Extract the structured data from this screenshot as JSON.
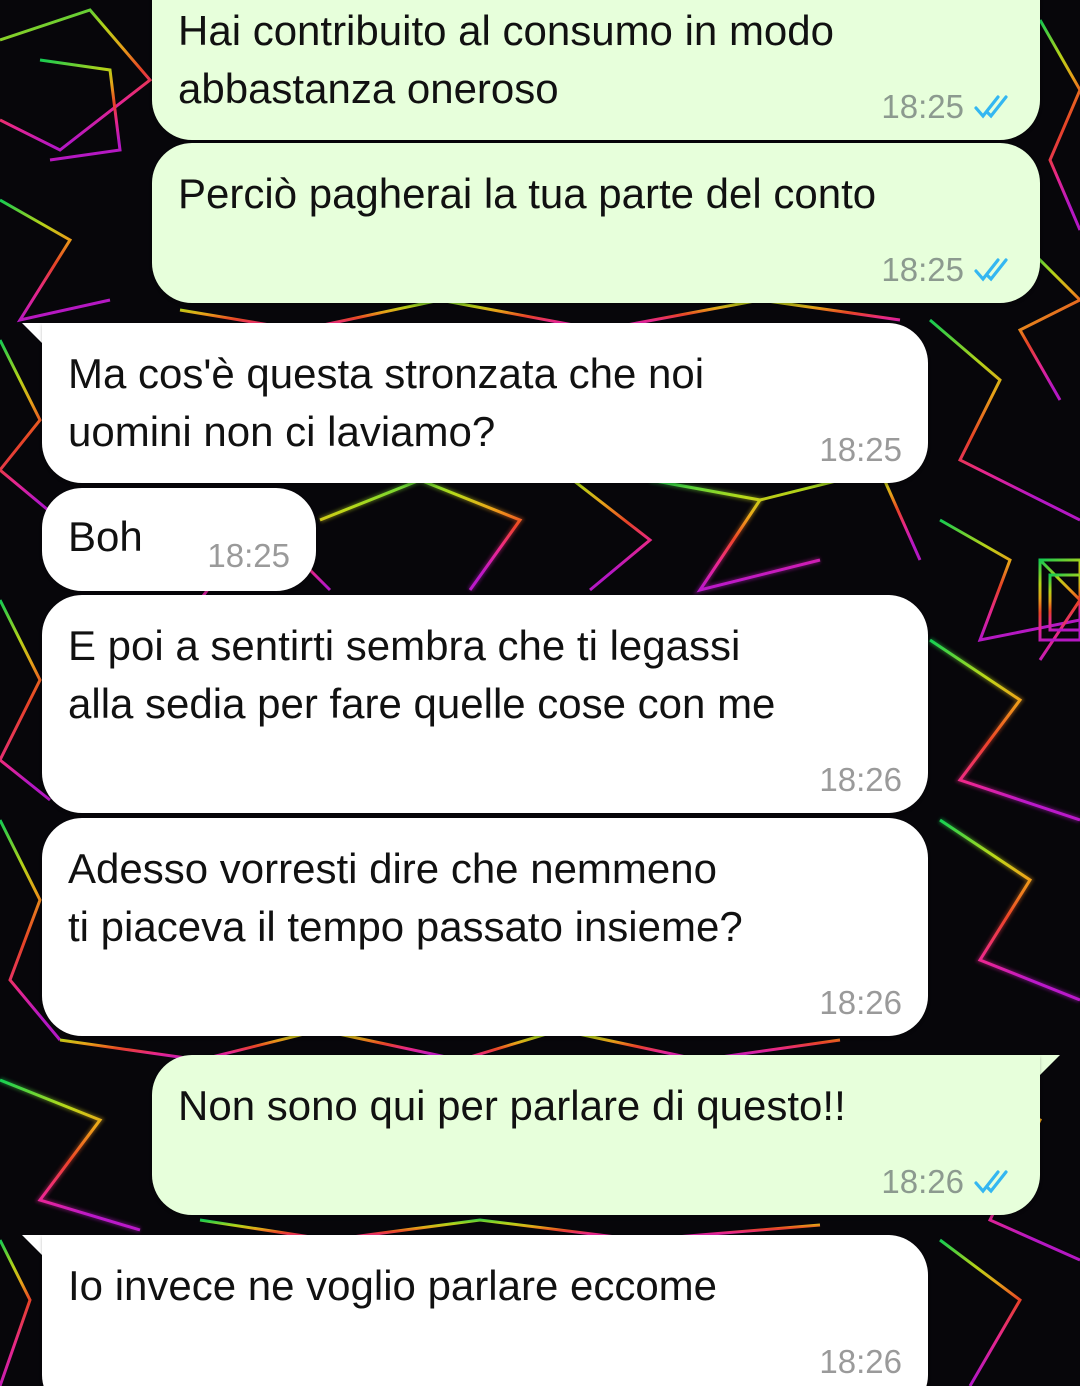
{
  "chat": {
    "messages": [
      {
        "direction": "outgoing",
        "text": "Hai contribuito al consumo in modo\nabbastanza oneroso",
        "time": "18:25",
        "read_ticks": "double-check-blue"
      },
      {
        "direction": "outgoing",
        "text": "Perciò pagherai la tua parte del conto",
        "time": "18:25",
        "read_ticks": "double-check-blue"
      },
      {
        "direction": "incoming",
        "text": "Ma cos'è questa stronzata che noi\nuomini non ci laviamo?",
        "time": "18:25"
      },
      {
        "direction": "incoming",
        "text": "Boh",
        "time": "18:25"
      },
      {
        "direction": "incoming",
        "text": "E poi a sentirti sembra che ti legassi\nalla sedia per fare quelle cose con me",
        "time": "18:26"
      },
      {
        "direction": "incoming",
        "text": "Adesso vorresti dire che nemmeno\nti piaceva il tempo passato insieme?",
        "time": "18:26"
      },
      {
        "direction": "outgoing",
        "text": "Non sono qui per parlare di questo!!",
        "time": "18:26",
        "read_ticks": "double-check-blue"
      },
      {
        "direction": "incoming",
        "text": "Io invece ne voglio parlare eccome",
        "time": "18:26"
      }
    ]
  },
  "colors": {
    "outgoing_bubble": "#e7ffdb",
    "incoming_bubble": "#ffffff",
    "read_tick": "#34b7f1",
    "wallpaper_base": "#07060a"
  },
  "wallpaper": {
    "description_icon": "neon-geometric-wallpaper"
  }
}
